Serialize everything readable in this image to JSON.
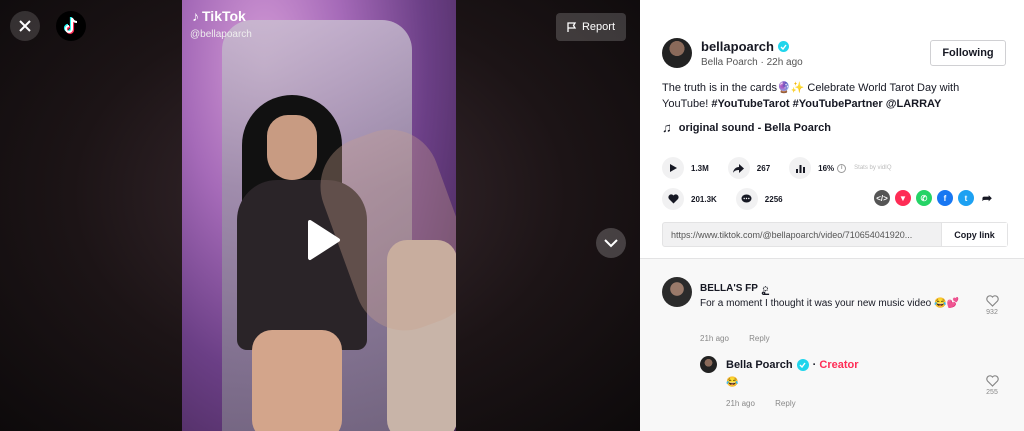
{
  "overlay": {
    "brand": "TikTok",
    "handle": "@bellapoarch",
    "report_label": "Report"
  },
  "author": {
    "username": "bellapoarch",
    "display_name": "Bella Poarch",
    "time": "22h ago",
    "follow_label": "Following"
  },
  "caption": {
    "text": "The truth is in the cards🔮✨ Celebrate World Tarot Day with YouTube!",
    "tags": [
      "#YouTubeTarot",
      "#YouTubePartner",
      "@LARRAY"
    ]
  },
  "sound": "original sound - Bella Poarch",
  "stats": {
    "plays": "1.3M",
    "shares": "267",
    "engagement": "16%",
    "stats_by": "Stats by vidIQ",
    "likes": "201.3K",
    "comments": "2256"
  },
  "link": {
    "url": "https://www.tiktok.com/@bellapoarch/video/710654041920...",
    "copy_label": "Copy link"
  },
  "comments": [
    {
      "name": "BELLA'S FP",
      "text": "For a moment I thought it was your new music video 😂💕",
      "time": "21h ago",
      "reply_label": "Reply",
      "likes": "932"
    },
    {
      "name": "Bella Poarch",
      "badge": "Creator",
      "text": "😂",
      "time": "21h ago",
      "reply_label": "Reply",
      "likes": "255"
    }
  ],
  "colors": {
    "accent": "#fe2c55",
    "verified": "#20d5ec"
  }
}
